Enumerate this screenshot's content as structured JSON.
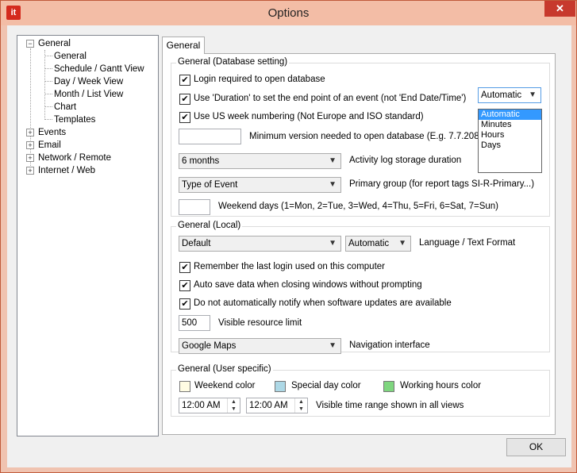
{
  "window": {
    "title": "Options",
    "app_icon": "it",
    "close_glyph": "✕"
  },
  "tree": {
    "items": [
      {
        "label": "General",
        "expander": "−"
      },
      {
        "label": "General"
      },
      {
        "label": "Schedule / Gantt View"
      },
      {
        "label": "Day / Week View"
      },
      {
        "label": "Month / List View"
      },
      {
        "label": "Chart"
      },
      {
        "label": "Templates"
      },
      {
        "label": "Events",
        "expander": "+"
      },
      {
        "label": "Email",
        "expander": "+"
      },
      {
        "label": "Network / Remote",
        "expander": "+"
      },
      {
        "label": "Internet / Web",
        "expander": "+"
      }
    ]
  },
  "tab": {
    "label": "General"
  },
  "db_group": {
    "title": "General (Database setting)",
    "login_required": {
      "label": "Login required to open database",
      "checked": true
    },
    "use_duration": {
      "label": "Use 'Duration' to set the end point of an event (not 'End Date/Time')",
      "checked": true
    },
    "duration_combo": {
      "value": "Automatic",
      "options": [
        "Automatic",
        "Minutes",
        "Hours",
        "Days"
      ]
    },
    "us_week": {
      "label": "Use US week numbering (Not Europe and ISO standard)",
      "checked": true
    },
    "min_version": {
      "value": "",
      "label": "Minimum version needed to open database (E.g. 7.7.208)"
    },
    "activity_log": {
      "value": "6 months",
      "label": "Activity log storage duration"
    },
    "primary_group": {
      "value": "Type of Event",
      "label": "Primary group (for report tags SI-R-Primary...)"
    },
    "weekend_days": {
      "value": "",
      "label": "Weekend days (1=Mon, 2=Tue, 3=Wed, 4=Thu, 5=Fri, 6=Sat, 7=Sun)"
    }
  },
  "local_group": {
    "title": "General (Local)",
    "language": {
      "value": "Default"
    },
    "text_format": {
      "value": "Automatic",
      "label": "Language / Text Format"
    },
    "remember_login": {
      "label": "Remember the last login used on this computer",
      "checked": true
    },
    "auto_save": {
      "label": "Auto save data when closing windows without prompting",
      "checked": true
    },
    "no_notify": {
      "label": "Do not automatically notify when software updates are available",
      "checked": true
    },
    "resource_limit": {
      "value": "500",
      "label": "Visible resource limit"
    },
    "navigation": {
      "value": "Google Maps",
      "label": "Navigation interface"
    }
  },
  "user_group": {
    "title": "General (User specific)",
    "weekend_color": {
      "label": "Weekend color",
      "color": "#fffce3"
    },
    "special_day_color": {
      "label": "Special day color",
      "color": "#add8e6"
    },
    "working_hours_color": {
      "label": "Working hours color",
      "color": "#7fd67f"
    },
    "time_start": {
      "value": "12:00 AM"
    },
    "time_end": {
      "value": "12:00 AM"
    },
    "time_range_label": "Visible time range shown in all views"
  },
  "footer": {
    "ok_label": "OK"
  },
  "glyphs": {
    "check": "✔",
    "down_arrow": "▼",
    "spin_up": "▲",
    "spin_down": "▼"
  }
}
